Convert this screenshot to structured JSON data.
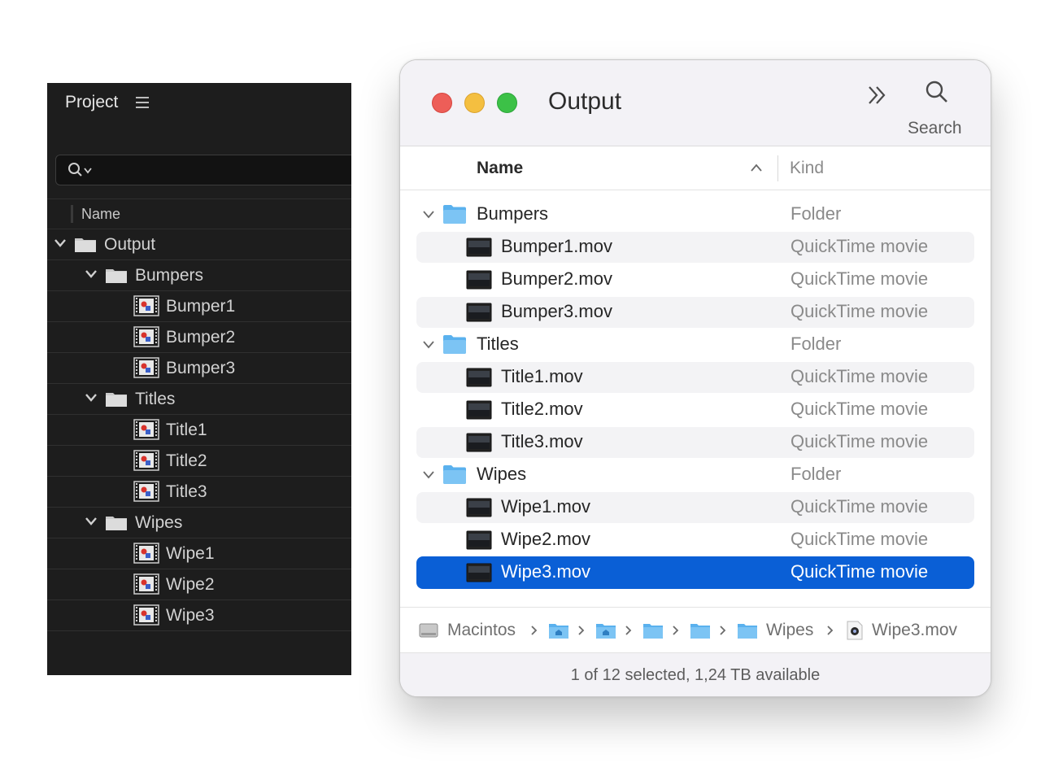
{
  "project_panel": {
    "title": "Project",
    "column_header": "Name",
    "rows": [
      {
        "label": "Output",
        "type": "folder",
        "level": 0
      },
      {
        "label": "Bumpers",
        "type": "folder",
        "level": 1
      },
      {
        "label": "Bumper1",
        "type": "comp",
        "level": 2
      },
      {
        "label": "Bumper2",
        "type": "comp",
        "level": 2
      },
      {
        "label": "Bumper3",
        "type": "comp",
        "level": 2
      },
      {
        "label": "Titles",
        "type": "folder",
        "level": 1
      },
      {
        "label": "Title1",
        "type": "comp",
        "level": 2
      },
      {
        "label": "Title2",
        "type": "comp",
        "level": 2
      },
      {
        "label": "Title3",
        "type": "comp",
        "level": 2
      },
      {
        "label": "Wipes",
        "type": "folder",
        "level": 1
      },
      {
        "label": "Wipe1",
        "type": "comp",
        "level": 2
      },
      {
        "label": "Wipe2",
        "type": "comp",
        "level": 2
      },
      {
        "label": "Wipe3",
        "type": "comp",
        "level": 2
      }
    ]
  },
  "finder": {
    "title": "Output",
    "search_label": "Search",
    "columns": {
      "name": "Name",
      "kind": "Kind"
    },
    "rows": [
      {
        "name": "Bumpers",
        "kind": "Folder",
        "type": "folder"
      },
      {
        "name": "Bumper1.mov",
        "kind": "QuickTime movie",
        "type": "movie"
      },
      {
        "name": "Bumper2.mov",
        "kind": "QuickTime movie",
        "type": "movie"
      },
      {
        "name": "Bumper3.mov",
        "kind": "QuickTime movie",
        "type": "movie"
      },
      {
        "name": "Titles",
        "kind": "Folder",
        "type": "folder"
      },
      {
        "name": "Title1.mov",
        "kind": "QuickTime movie",
        "type": "movie"
      },
      {
        "name": "Title2.mov",
        "kind": "QuickTime movie",
        "type": "movie"
      },
      {
        "name": "Title3.mov",
        "kind": "QuickTime movie",
        "type": "movie"
      },
      {
        "name": "Wipes",
        "kind": "Folder",
        "type": "folder"
      },
      {
        "name": "Wipe1.mov",
        "kind": "QuickTime movie",
        "type": "movie"
      },
      {
        "name": "Wipe2.mov",
        "kind": "QuickTime movie",
        "type": "movie"
      },
      {
        "name": "Wipe3.mov",
        "kind": "QuickTime movie",
        "type": "movie",
        "selected": true
      }
    ],
    "path": [
      {
        "label": "Macintos",
        "icon": "hard-drive-icon"
      },
      {
        "label": "",
        "icon": "home-folder-icon"
      },
      {
        "label": "",
        "icon": "home-folder-icon"
      },
      {
        "label": "",
        "icon": "folder-icon"
      },
      {
        "label": "",
        "icon": "folder-icon"
      },
      {
        "label": "Wipes",
        "icon": "folder-icon"
      },
      {
        "label": "Wipe3.mov",
        "icon": "movie-file-icon"
      }
    ],
    "status": "1 of 12 selected, 1,24 TB available"
  },
  "colors": {
    "selection": "#0a5fd6",
    "folder_blue": "#5ab1ee",
    "project_bg": "#1d1d1d",
    "close": "#ed5e58",
    "minimize": "#f4bf40",
    "zoom": "#3cc147"
  }
}
